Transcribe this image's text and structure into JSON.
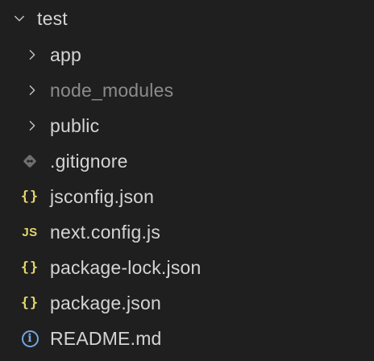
{
  "explorer": {
    "root": {
      "label": "test",
      "expanded": true,
      "icon": "chevron-down-icon"
    },
    "folders": [
      {
        "label": "app",
        "expanded": false,
        "icon": "chevron-right-icon",
        "dimmed": false
      },
      {
        "label": "node_modules",
        "expanded": false,
        "icon": "chevron-right-icon",
        "dimmed": true
      },
      {
        "label": "public",
        "expanded": false,
        "icon": "chevron-right-icon",
        "dimmed": false
      }
    ],
    "files": [
      {
        "label": ".gitignore",
        "icon": "git-icon"
      },
      {
        "label": "jsconfig.json",
        "icon": "json-icon",
        "icon_text": "{}"
      },
      {
        "label": "next.config.js",
        "icon": "javascript-icon",
        "icon_text": "JS"
      },
      {
        "label": "package-lock.json",
        "icon": "json-icon",
        "icon_text": "{}"
      },
      {
        "label": "package.json",
        "icon": "json-icon",
        "icon_text": "{}"
      },
      {
        "label": "README.md",
        "icon": "info-icon",
        "icon_text": "i"
      }
    ]
  },
  "colors": {
    "background": "#1f1f20",
    "text": "#d4d4d4",
    "dimmed_text": "#8c8c8c",
    "json_icon": "#e5d56c",
    "js_icon": "#e5d56c",
    "info_icon": "#74a5e0",
    "git_icon": "#7a7a7a"
  }
}
